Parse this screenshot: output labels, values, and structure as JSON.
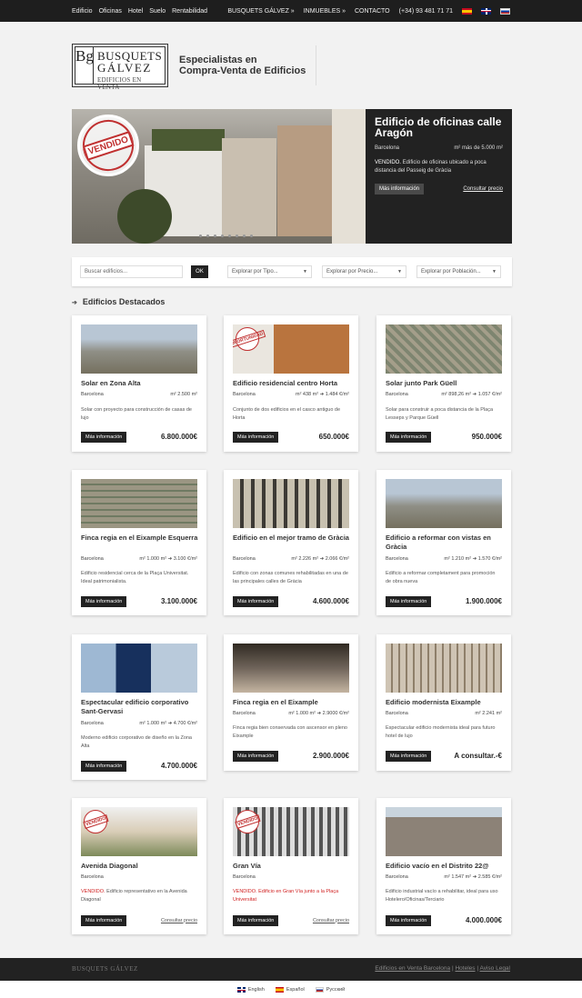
{
  "topnav": {
    "left": [
      "Edificio",
      "Oficinas",
      "Hotel",
      "Suelo",
      "Rentabilidad"
    ],
    "brand": "BUSQUETS GÁLVEZ »",
    "inmuebles": "INMUEBLES »",
    "contacto": "CONTACTO",
    "phone": "(+34) 93 481 71 71"
  },
  "logo": {
    "mono": "Bg",
    "line1": "BUSQUETS",
    "line2": "GÁLVEZ",
    "line3": "EDIFICIOS EN VENTA"
  },
  "tagline": {
    "line1": "Especialistas en",
    "line2": "Compra-Venta de Edificios"
  },
  "slider": {
    "stamp": "VENDIDO",
    "title": "Edificio de oficinas calle Aragón",
    "city": "Barcelona",
    "area": "m² más de 5.000 m²",
    "desc_prefix": "VENDIDO.",
    "desc": " Edificio de oficinas ubicado a poca distancia del Passeig de Gràcia",
    "btn": "Más información",
    "consult": "Consultar precio"
  },
  "search": {
    "placeholder": "Buscar edificios...",
    "ok": "OK",
    "tipo": "Explorar por Tipo...",
    "precio": "Explorar por Precio...",
    "poblacion": "Explorar por Población..."
  },
  "section_title": "Edificios Destacados",
  "cards": [
    {
      "title": "Solar en Zona Alta",
      "city": "Barcelona",
      "area": "m² 2.500 m²",
      "desc": "Solar con proyecto para construcción de casas de lujo",
      "btn": "Más información",
      "price": "6.800.000€"
    },
    {
      "title": "Edificio residencial centro Horta",
      "stamp": "OPORTUNIDAD",
      "city": "Barcelona",
      "area": "m² 438 m² ➔ 1.484 €/m²",
      "desc": "Conjunto de dos edificios en el casco antiguo de Horta",
      "btn": "Más información",
      "price": "650.000€"
    },
    {
      "title": "Solar junto Park Güell",
      "city": "Barcelona",
      "area": "m² 898,26 m² ➔ 1.057 €/m²",
      "desc": "Solar para construir a poca distancia de la Plaça Lesseps y Parque Güell",
      "btn": "Más información",
      "price": "950.000€"
    },
    {
      "title": "Finca regia en el Eixample Esquerra",
      "city": "Barcelona",
      "area": "m² 1.000 m² ➔ 3.100 €/m²",
      "desc": "Edificio residencial cerca de la Plaça Universitat. Ideal patrimonialista.",
      "btn": "Más información",
      "price": "3.100.000€"
    },
    {
      "title": "Edificio en el mejor tramo de Gràcia",
      "city": "Barcelona",
      "area": "m² 2.226 m² ➔ 2.066 €/m²",
      "desc": "Edificio con zonas comunes rehabilitadas en una de las principales calles de Gràcia",
      "btn": "Más información",
      "price": "4.600.000€"
    },
    {
      "title": "Edificio a reformar con vistas en Gràcia",
      "city": "Barcelona",
      "area": "m² 1.210 m² ➔ 1.570 €/m²",
      "desc": "Edificio a reformar completament para  promoción de obra nueva",
      "btn": "Más información",
      "price": "1.900.000€"
    },
    {
      "title": "Espectacular edificio corporativo Sant-Gervasi",
      "city": "Barcelona",
      "area": "m² 1.000 m² ➔ 4.700 €/m²",
      "desc": "Moderno edificio corporativo de diseño en la Zona Alta",
      "btn": "Más información",
      "price": "4.700.000€"
    },
    {
      "title": "Finca regia en el Eixample",
      "city": "Barcelona",
      "area": "m² 1.000 m² ➔ 2.9000 €/m²",
      "desc": "Finca regia bien conservada con ascensor en pleno Eixample",
      "btn": "Más información",
      "price": "2.900.000€"
    },
    {
      "title": "Edificio modernista Eixample",
      "city": "Barcelona",
      "area": "m² 2.241 m²",
      "desc": "Espectacular edificio modernista ideal para futuro hotel de lujo",
      "btn": "Más información",
      "price": "A consultar.-€"
    },
    {
      "title": "Avenida Diagonal",
      "stamp": "VENDIDO",
      "city": "Barcelona",
      "area": "",
      "desc_red": "VENDIDO.",
      "desc": " Edificio representativo en la Avenida Diagonal",
      "btn": "Más información",
      "consult": "Consultar precio"
    },
    {
      "title": "Gran Vía",
      "stamp": "VENDIDO",
      "city": "Barcelona",
      "area": "",
      "desc_red": "VENDIDO. Edificio en Gran Vía junto a la Plaça Universitat",
      "desc": "",
      "btn": "Más información",
      "consult": "Consultar precio"
    },
    {
      "title": "Edificio vacío en el Distrito 22@",
      "city": "Barcelona",
      "area": "m² 1.547 m² ➔ 2.585 €/m²",
      "desc": "Edificio industrial vacío a rehabilitar, ideal para uso Hotelero/Oficinas/Terciario",
      "btn": "Más información",
      "price": "4.000.000€"
    }
  ],
  "footer": {
    "brand": "BUSQUETS GÁLVEZ",
    "links": [
      "Edificios en Venta Barcelona",
      "Hoteles",
      "Aviso Legal"
    ],
    "sep": "|"
  },
  "langs": [
    "English",
    "Español",
    "Русский"
  ]
}
